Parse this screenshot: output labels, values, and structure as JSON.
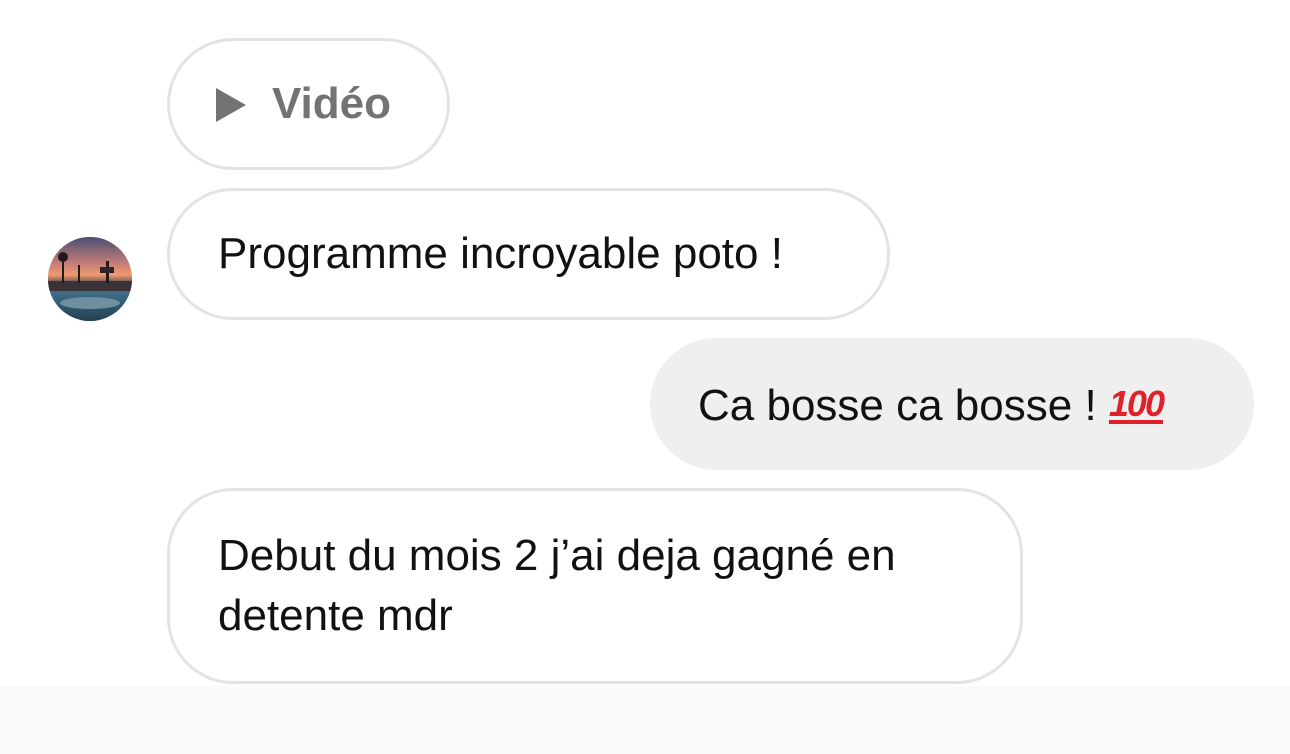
{
  "thread": {
    "video_label": "Vidéo",
    "messages": [
      {
        "sender": "them",
        "text": "Programme incroyable poto !"
      },
      {
        "sender": "me",
        "text": "Ca bosse ca bosse !",
        "emoji": "100"
      },
      {
        "sender": "them",
        "text": "Debut du mois 2 j’ai deja gagné en detente mdr"
      }
    ]
  },
  "icons": {
    "play": "play-icon",
    "hundred": "hundred-points-emoji"
  },
  "colors": {
    "received_border": "#e3e3e3",
    "sent_bubble": "#efefef",
    "text": "#111111",
    "video_label": "#737373",
    "emoji_red": "#e0212a"
  }
}
